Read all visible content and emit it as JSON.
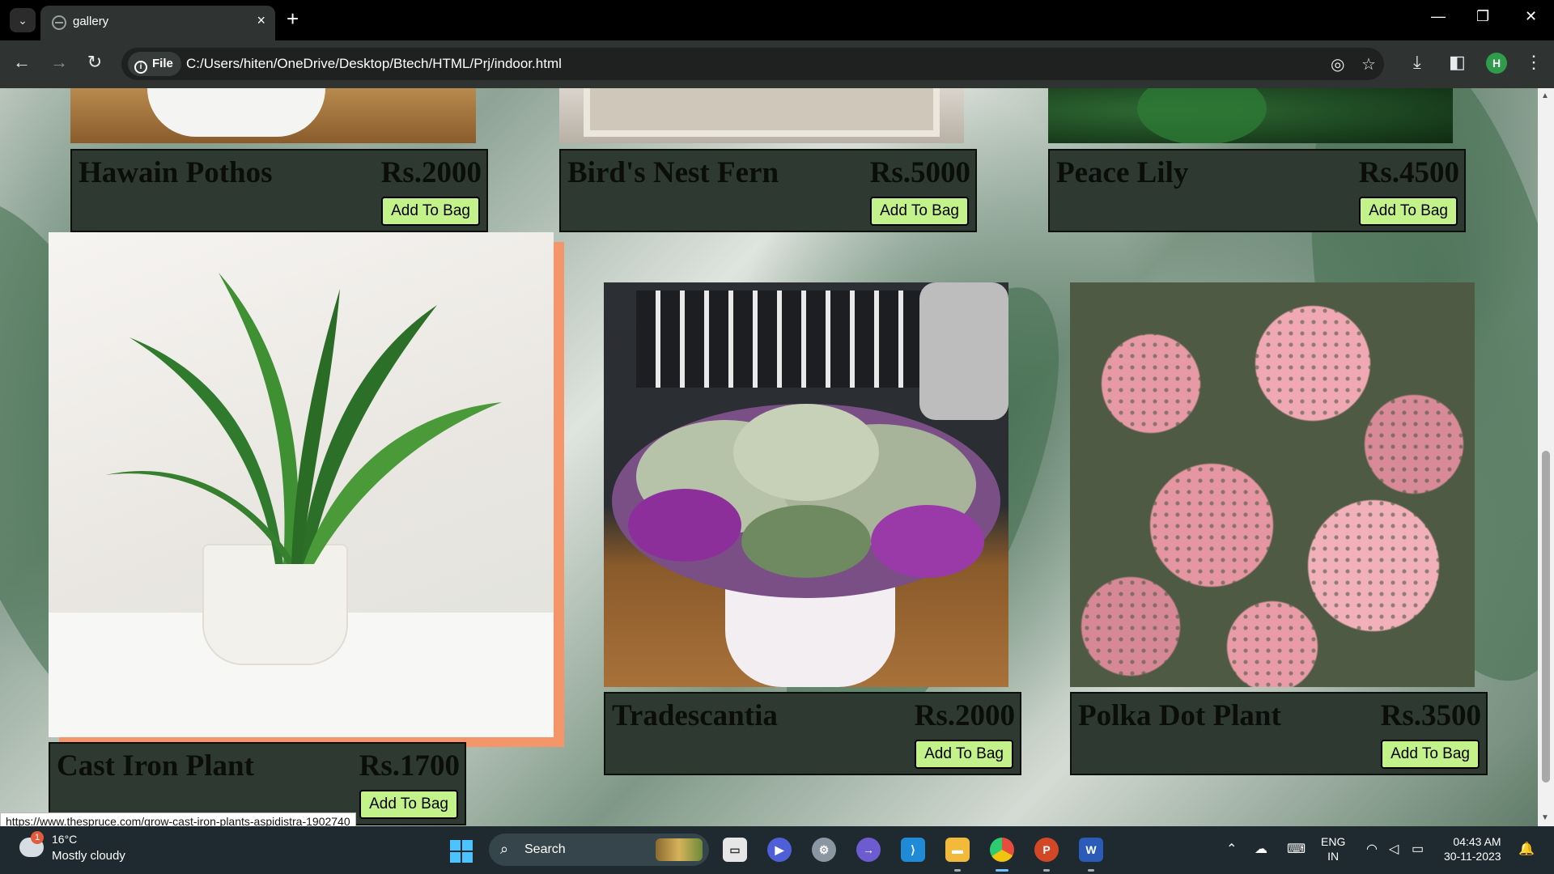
{
  "browser": {
    "tab": {
      "title": "gallery",
      "close_icon": "×"
    },
    "new_tab_icon": "+",
    "window_controls": {
      "minimize": "—",
      "restore": "❐",
      "close": "✕"
    },
    "nav": {
      "back": "←",
      "forward": "→",
      "reload": "↻"
    },
    "address": {
      "chip_label": "File",
      "url": "C:/Users/hiten/OneDrive/Desktop/Btech/HTML/Prj/indoor.html"
    },
    "profile_initial": "H",
    "link_hover_status": "https://www.thespruce.com/grow-cast-iron-plants-aspidistra-1902740"
  },
  "page": {
    "accent_colors": {
      "card_bg": "#2e3a31",
      "button_bg": "#c4f28a",
      "hover_frame": "#f5956a"
    },
    "products": [
      {
        "name": "Hawain Pothos",
        "price": "Rs.2000",
        "button": "Add To Bag"
      },
      {
        "name": "Bird's Nest Fern",
        "price": "Rs.5000",
        "button": "Add To Bag"
      },
      {
        "name": "Peace Lily",
        "price": "Rs.4500",
        "button": "Add To Bag"
      },
      {
        "name": "Cast Iron Plant",
        "price": "Rs.1700",
        "button": "Add To Bag"
      },
      {
        "name": "Tradescantia",
        "price": "Rs.2000",
        "button": "Add To Bag"
      },
      {
        "name": "Polka Dot Plant",
        "price": "Rs.3500",
        "button": "Add To Bag"
      }
    ]
  },
  "taskbar": {
    "weather": {
      "badge": "1",
      "temp": "16°C",
      "desc": "Mostly cloudy"
    },
    "search_label": "Search",
    "language": {
      "line1": "ENG",
      "line2": "IN"
    },
    "clock": {
      "time": "04:43 AM",
      "date": "30-11-2023"
    }
  }
}
